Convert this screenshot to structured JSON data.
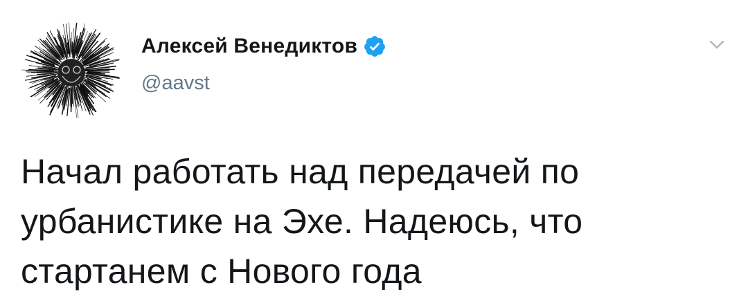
{
  "author": {
    "display_name": "Алексей Венедиктов",
    "handle": "@aavst",
    "verified": true,
    "avatar_icon": "avatar-icon",
    "verified_icon": "verified-badge-icon"
  },
  "tweet": {
    "text": "Начал работать над передачей по\nурбанистике на Эхе. Надеюсь, что\nстартанем с Нового года"
  },
  "menu": {
    "icon": "chevron-down-icon"
  },
  "colors": {
    "verified_blue": "#1da1f2",
    "handle_gray": "#657786",
    "text_dark": "#14171a",
    "caret_gray": "#aab8c2"
  }
}
